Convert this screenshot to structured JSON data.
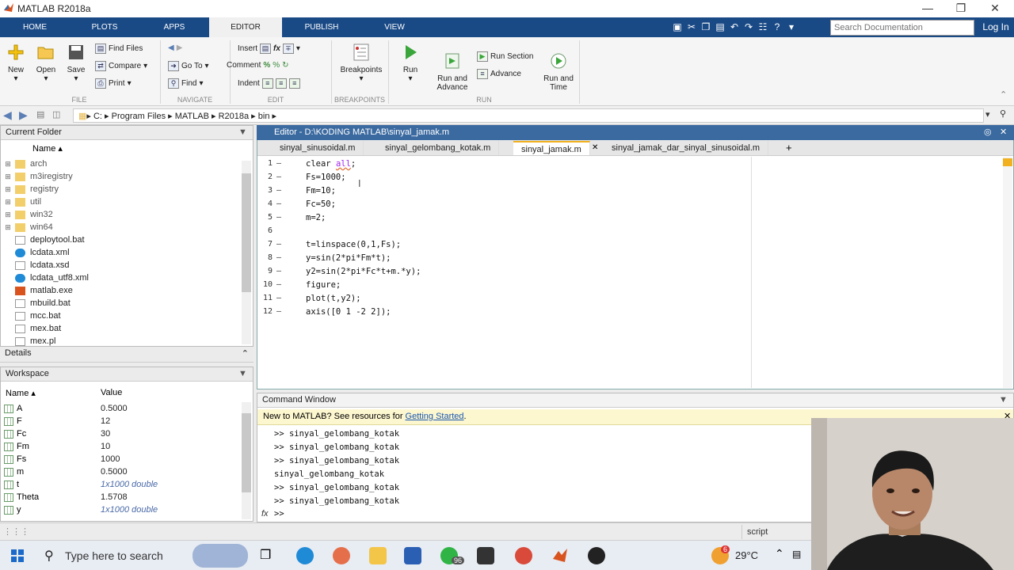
{
  "app": {
    "title": "MATLAB R2018a"
  },
  "tabs": [
    {
      "label": "HOME"
    },
    {
      "label": "PLOTS"
    },
    {
      "label": "APPS"
    },
    {
      "label": "EDITOR"
    },
    {
      "label": "PUBLISH"
    },
    {
      "label": "VIEW"
    }
  ],
  "search": {
    "placeholder": "Search Documentation"
  },
  "login": "Log In",
  "ribbon": {
    "file": {
      "new": "New",
      "open": "Open",
      "save": "Save",
      "find_files": "Find Files",
      "compare": "Compare",
      "print": "Print",
      "group": "FILE"
    },
    "navigate": {
      "go_to": "Go To",
      "find": "Find",
      "group": "NAVIGATE"
    },
    "edit": {
      "insert": "Insert",
      "comment": "Comment",
      "indent": "Indent",
      "group": "EDIT"
    },
    "breakpoints": {
      "label": "Breakpoints",
      "group": "BREAKPOINTS"
    },
    "run": {
      "run": "Run",
      "run_advance": "Run and\nAdvance",
      "run_section": "Run Section",
      "advance": "Advance",
      "run_time": "Run and\nTime",
      "group": "RUN"
    }
  },
  "address": {
    "path": [
      "C:",
      "Program Files",
      "MATLAB",
      "R2018a",
      "bin"
    ]
  },
  "current_folder": {
    "title": "Current Folder",
    "col_name": "Name",
    "items": [
      {
        "name": "arch",
        "type": "folder"
      },
      {
        "name": "m3iregistry",
        "type": "folder"
      },
      {
        "name": "registry",
        "type": "folder"
      },
      {
        "name": "util",
        "type": "folder"
      },
      {
        "name": "win32",
        "type": "folder"
      },
      {
        "name": "win64",
        "type": "folder"
      },
      {
        "name": "deploytool.bat",
        "type": "file"
      },
      {
        "name": "lcdata.xml",
        "type": "edge"
      },
      {
        "name": "lcdata.xsd",
        "type": "file"
      },
      {
        "name": "lcdata_utf8.xml",
        "type": "edge"
      },
      {
        "name": "matlab.exe",
        "type": "matlab"
      },
      {
        "name": "mbuild.bat",
        "type": "file"
      },
      {
        "name": "mcc.bat",
        "type": "file"
      },
      {
        "name": "mex.bat",
        "type": "file"
      },
      {
        "name": "mex.pl",
        "type": "file"
      }
    ]
  },
  "details": {
    "title": "Details"
  },
  "workspace": {
    "title": "Workspace",
    "col_name": "Name",
    "col_value": "Value",
    "vars": [
      {
        "name": "A",
        "value": "0.5000",
        "italic": false
      },
      {
        "name": "F",
        "value": "12",
        "italic": false
      },
      {
        "name": "Fc",
        "value": "30",
        "italic": false
      },
      {
        "name": "Fm",
        "value": "10",
        "italic": false
      },
      {
        "name": "Fs",
        "value": "1000",
        "italic": false
      },
      {
        "name": "m",
        "value": "0.5000",
        "italic": false
      },
      {
        "name": "t",
        "value": "1x1000 double",
        "italic": true
      },
      {
        "name": "Theta",
        "value": "1.5708",
        "italic": false
      },
      {
        "name": "y",
        "value": "1x1000 double",
        "italic": true
      }
    ]
  },
  "editor": {
    "title": "Editor - D:\\KODING MATLAB\\sinyal_jamak.m",
    "tabs": [
      "sinyal_sinusoidal.m",
      "sinyal_gelombang_kotak.m",
      "sinyal_jamak.m",
      "sinyal_jamak_dar_sinyal_sinusoidal.m"
    ],
    "active_tab": 2,
    "lines": [
      "clear all;",
      "Fs=1000;",
      "Fm=10;",
      "Fc=50;",
      "m=2;",
      "",
      "t=linspace(0,1,Fs);",
      "y=sin(2*pi*Fm*t);",
      "y2=sin(2*pi*Fc*t+m.*y);",
      "figure;",
      "plot(t,y2);",
      "axis([0 1 -2 2]);"
    ]
  },
  "command_window": {
    "title": "Command Window",
    "banner_text": "New to MATLAB? See resources for ",
    "banner_link": "Getting Started",
    "banner_end": ".",
    "lines": [
      ">> sinyal_gelombang_kotak",
      ">> sinyal_gelombang_kotak",
      ">> sinyal_gelombang_kotak",
      "sinyal_gelombang_kotak",
      ">> sinyal_gelombang_kotak",
      ">> sinyal_gelombang_kotak"
    ],
    "prompt": ">>",
    "fx": "fx"
  },
  "status": {
    "mode": "script"
  },
  "taskbar": {
    "search_placeholder": "Type here to search",
    "temp": "29°C",
    "badge_whatsapp": "96",
    "badge_weather": "6"
  },
  "colors": {
    "tab_bar": "#1a4a86",
    "editor_header": "#3b6aa0",
    "accent": "#f0b020"
  }
}
